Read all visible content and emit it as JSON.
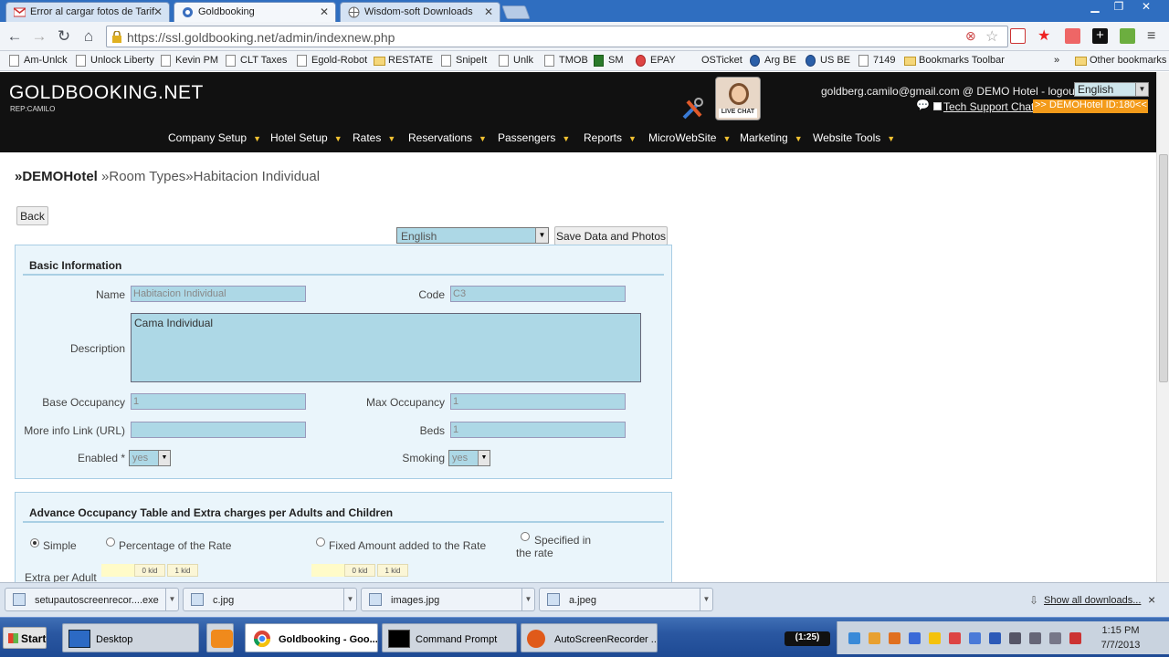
{
  "browser": {
    "tabs": [
      {
        "label": "Error al cargar fotos de Tarif",
        "icon": "gmail-icon"
      },
      {
        "label": "Goldbooking",
        "icon": "globe-icon"
      },
      {
        "label": "Wisdom-soft Downloads",
        "icon": "globe-icon"
      }
    ],
    "url": "https://ssl.goldbooking.net/admin/indexnew.php",
    "bookmarks": [
      "Am-Unlck",
      "Unlock Liberty",
      "Kevin PM",
      "CLT Taxes",
      "Egold-Robot",
      "RESTATE",
      "SnipeIt",
      "Unlk",
      "TMOB",
      "SM",
      "EPAY",
      "OSTicket",
      "Arg BE",
      "US BE",
      "7149",
      "Bookmarks Toolbar"
    ],
    "bookmarks_more": "»",
    "other_bookmarks": "Other bookmarks"
  },
  "site": {
    "logo": "GOLDBOOKING.NET",
    "rep": "REP:CAMILO",
    "user_line": "goldberg.camilo@gmail.com @ DEMO Hotel - logout",
    "language": "English",
    "support_link": "Tech Support Chat",
    "hotel_id": ">> DEMOHotel ID:180<<",
    "live_chat": "LIVE CHAT",
    "nav": [
      "Company Setup",
      "Hotel Setup",
      "Rates",
      "Reservations",
      "Passengers",
      "Reports",
      "MicroWebSite",
      "Marketing",
      "Website Tools"
    ]
  },
  "page": {
    "breadcrumb": {
      "hotel": "»DEMOHotel",
      "section": "»Room Types",
      "item": "»Habitacion Individual"
    },
    "back_label": "Back",
    "form_language": "English",
    "save_label": "Save Data and Photos"
  },
  "basic": {
    "title": "Basic Information",
    "name_label": "Name",
    "name_value": "Habitacion Individual",
    "code_label": "Code",
    "code_value": "C3",
    "desc_label": "Description",
    "desc_value": "Cama Individual",
    "base_occ_label": "Base Occupancy",
    "base_occ_value": "1",
    "max_occ_label": "Max Occupancy",
    "max_occ_value": "1",
    "link_label": "More info Link (URL)",
    "link_value": "",
    "beds_label": "Beds",
    "beds_value": "1",
    "enabled_label": "Enabled *",
    "enabled_value": "yes",
    "smoking_label": "Smoking",
    "smoking_value": "yes"
  },
  "advance": {
    "title": "Advance Occupancy Table and Extra charges per Adults and Children",
    "opt_simple": "Simple",
    "opt_percentage": "Percentage of the Rate",
    "opt_fixed": "Fixed Amount added to the Rate",
    "opt_specified_1": "Specified in",
    "opt_specified_2": "the rate",
    "extra_label": "Extra per Adult",
    "kid0": "0 kid",
    "kid1": "1 kid"
  },
  "downloads": {
    "items": [
      "setupautoscreenrecor....exe",
      "c.jpg",
      "images.jpg",
      "a.jpeg"
    ],
    "show_all": "Show all downloads...",
    "close": "×"
  },
  "taskbar": {
    "start": "Start",
    "tasks": [
      "Desktop",
      "Goldbooking - Goo...",
      "Command Prompt",
      "AutoScreenRecorder ..."
    ],
    "rec_time": "(1:25)",
    "time": "1:15 PM",
    "date": "7/7/2013"
  }
}
